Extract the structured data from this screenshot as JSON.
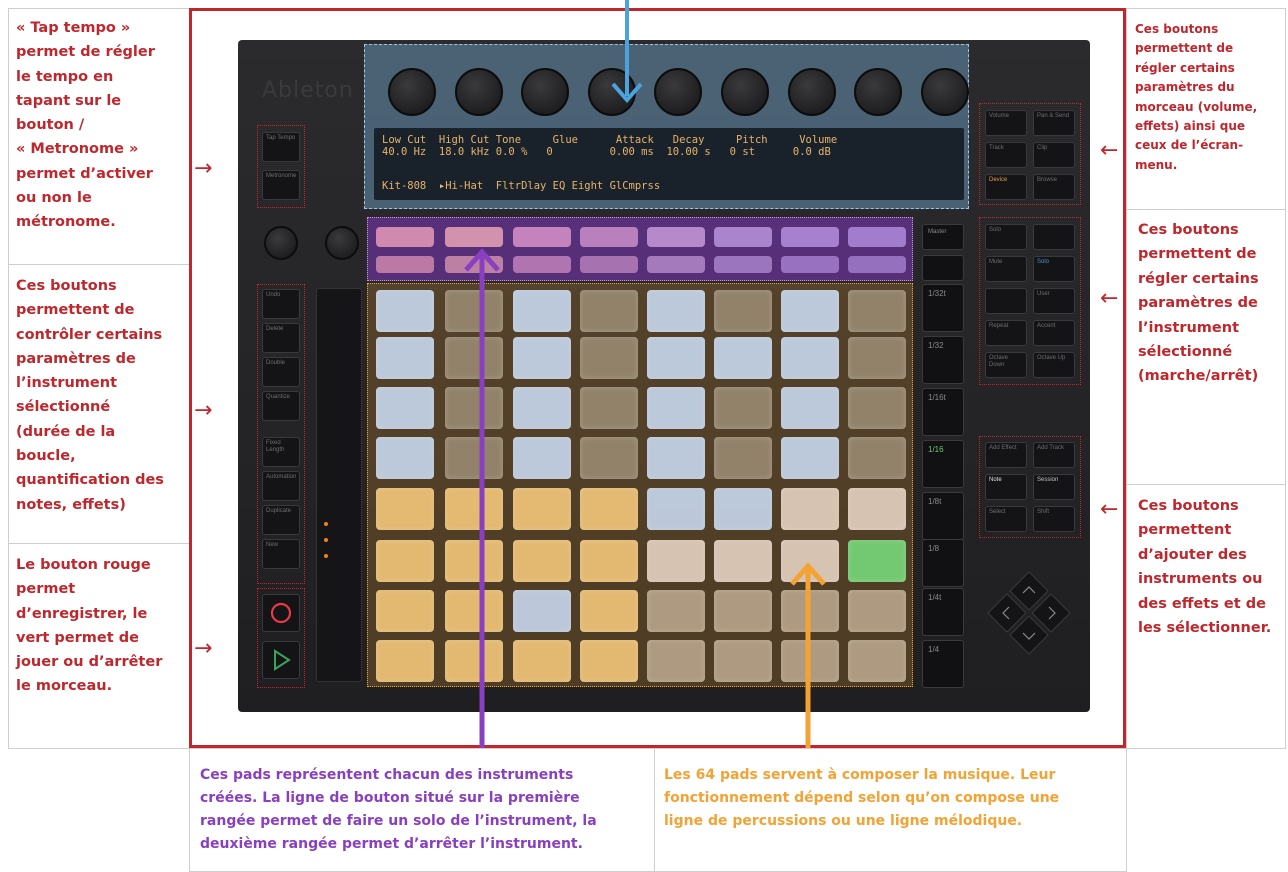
{
  "annotations": {
    "tap_tempo": "« Tap tempo »\npermet de régler\nle tempo en\ntapant sur le\nbouton /\n« Metronome »\npermet d’activer\nou non le\nmétronome.",
    "left_controls": "Ces boutons\npermettent de\ncontrôler certains\nparamètres de\nl’instrument\nsélectionné\n(durée de la\nboucle,\nquantification des\nnotes, effets)",
    "record_play": "Le bouton rouge\npermet\nd’enregistrer, le\nvert permet de\njouer ou d’arrêter\nle morceau.",
    "right_track": "Ces boutons\npermettent de\nrégler certains\nparamètres du\nmorceau (volume,\neffets) ainsi que\nceux de l’écran-\nmenu.",
    "right_instrument": "Ces boutons\npermettent de\nrégler certains\nparamètres de\nl’instrument\nsélectionné\n(marche/arrêt)",
    "right_add": "Ces boutons\npermettent\nd’ajouter des\ninstruments ou\ndes effets et de\nles sélectionner.",
    "bottom_purple": "Ces pads représentent chacun des instruments\ncréées. La ligne de bouton situé sur la première\nrangée permet de faire un solo de l’instrument, la\ndeuxième rangée permet d’arrêter l’instrument.",
    "bottom_orange": "Les 64 pads servent à composer la musique. Leur\nfonctionnement dépend selon qu’on compose une\nligne de percussions ou une ligne mélodique."
  },
  "device": {
    "brand": "Ableton",
    "lcd_row1": "Low Cut  High Cut Tone     Glue      Attack   Decay     Pitch     Volume",
    "lcd_row2": "40.0 Hz  18.0 kHz 0.0 %   0         0.00 ms  10.00 s   0 st      0.0 dB",
    "lcd_row3": "Kit-808  ▸Hi-Hat  FltrDlay EQ Eight GlCmprss",
    "left_top_buttons": [
      "Tap Tempo",
      "Metronome"
    ],
    "left_buttons": [
      "Undo",
      "Delete",
      "Double",
      "Quantize",
      "Fixed Length",
      "Automation",
      "Duplicate",
      "New"
    ],
    "right_top_buttons": [
      "Volume",
      "Pan & Send",
      "Track",
      "Clip",
      "Device",
      "Browse"
    ],
    "right_mid_buttons": [
      "Solo",
      "",
      "Mute",
      "Solo",
      "",
      "User",
      "Repeat",
      "Accent",
      "Octave Down",
      "Octave Up"
    ],
    "right_low_buttons": [
      "Add Effect",
      "Add Track",
      "Note",
      "Session",
      "Select",
      "Shift"
    ],
    "master_buttons": [
      "Master",
      ""
    ],
    "timing_buttons": [
      "1/32t",
      "1/32",
      "1/16t",
      "1/16",
      "1/8t",
      "1/8",
      "1/4t",
      "1/4"
    ]
  },
  "colors": {
    "red": "#c0272d",
    "purple": "#7a3bb0",
    "orange": "#f5a234",
    "blue": "#4aa3df"
  }
}
